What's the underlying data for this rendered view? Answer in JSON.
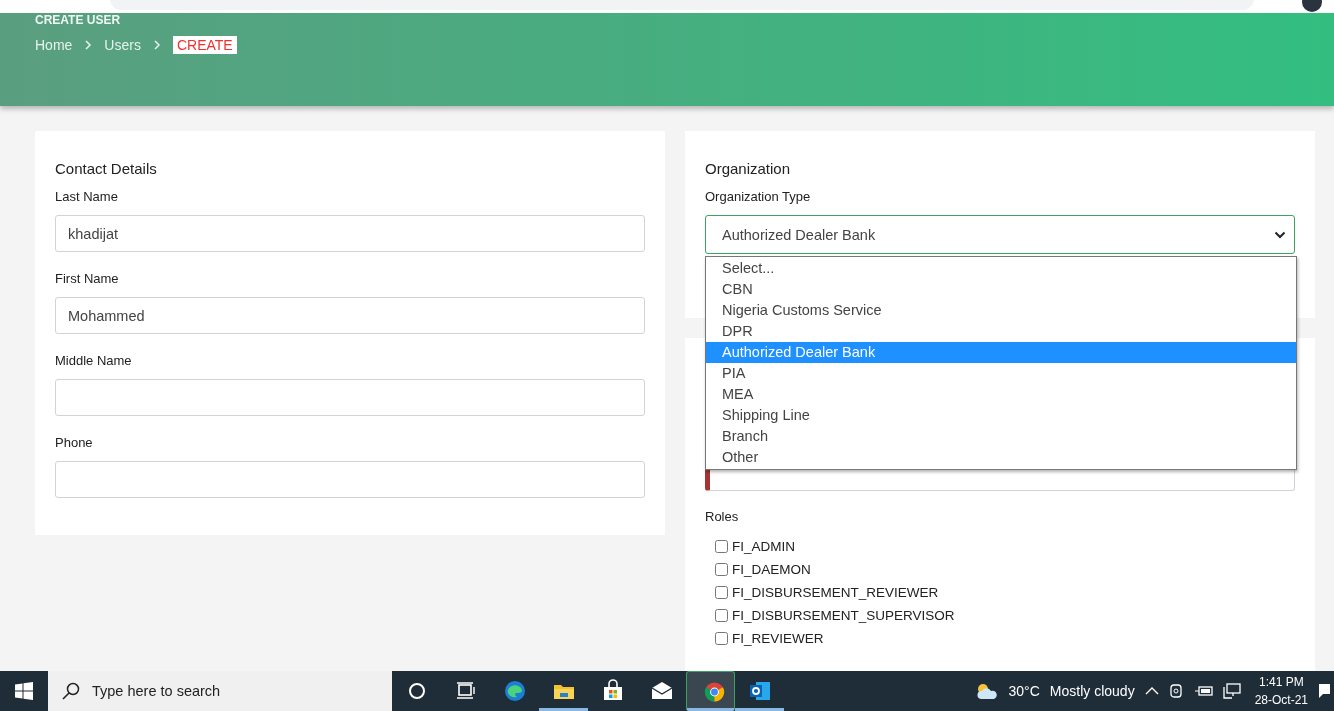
{
  "header": {
    "title": "CREATE USER",
    "breadcrumb": [
      {
        "label": "Home",
        "current": false
      },
      {
        "label": "Users",
        "current": false
      },
      {
        "label": "CREATE",
        "current": true
      }
    ]
  },
  "contact": {
    "title": "Contact Details",
    "fields": [
      {
        "label": "Last Name",
        "value": "khadijat"
      },
      {
        "label": "First Name",
        "value": "Mohammed"
      },
      {
        "label": "Middle Name"
      },
      {
        "label": "Phone"
      }
    ]
  },
  "organization": {
    "title": "Organization",
    "type_label": "Organization Type",
    "value": "Authorized Dealer Bank",
    "options": [
      {
        "label": "Select...",
        "selected": false
      },
      {
        "label": "CBN",
        "selected": false
      },
      {
        "label": "Nigeria Customs Service",
        "selected": false
      },
      {
        "label": "DPR",
        "selected": false
      },
      {
        "label": "Authorized Dealer Bank",
        "selected": true
      },
      {
        "label": "PIA",
        "selected": false
      },
      {
        "label": "MEA",
        "selected": false
      },
      {
        "label": "Shipping Line",
        "selected": false
      },
      {
        "label": "Branch",
        "selected": false
      },
      {
        "label": "Other",
        "selected": false
      }
    ]
  },
  "account": {
    "username_invalid": true,
    "roles_label": "Roles",
    "roles": [
      {
        "label": "FI_ADMIN",
        "checked": false
      },
      {
        "label": "FI_DAEMON",
        "checked": false
      },
      {
        "label": "FI_DISBURSEMENT_REVIEWER",
        "checked": false
      },
      {
        "label": "FI_DISBURSEMENT_SUPERVISOR",
        "checked": false
      },
      {
        "label": "FI_REVIEWER",
        "checked": false
      }
    ]
  },
  "taskbar": {
    "search_placeholder": "Type here to search",
    "apps": [
      {
        "kind": "cortana",
        "selected": false,
        "running": false
      },
      {
        "kind": "taskview",
        "selected": false,
        "running": false
      },
      {
        "kind": "edge",
        "selected": false,
        "running": false
      },
      {
        "kind": "explorer",
        "selected": false,
        "running": true
      },
      {
        "kind": "store",
        "selected": false,
        "running": false
      },
      {
        "kind": "mail",
        "selected": false,
        "running": false
      },
      {
        "kind": "chrome",
        "selected": true,
        "running": true
      },
      {
        "kind": "outlook",
        "selected": false,
        "running": true
      }
    ],
    "temperature": "30°C",
    "weather": "Mostly cloudy",
    "time": "1:41 PM",
    "date": "28-Oct-21"
  }
}
